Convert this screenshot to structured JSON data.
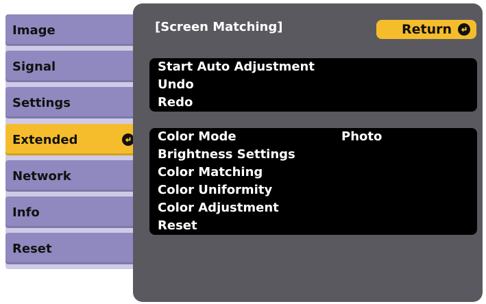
{
  "sidebar": {
    "items": [
      {
        "label": "Image"
      },
      {
        "label": "Signal"
      },
      {
        "label": "Settings"
      },
      {
        "label": "Extended"
      },
      {
        "label": "Network"
      },
      {
        "label": "Info"
      },
      {
        "label": "Reset"
      }
    ]
  },
  "main": {
    "heading": "[Screen Matching]",
    "return_label": "Return",
    "group1": [
      "Start Auto Adjustment",
      "Undo",
      "Redo"
    ],
    "group2": [
      {
        "label": "Color Mode",
        "value": "Photo"
      },
      {
        "label": "Brightness Settings"
      },
      {
        "label": "Color Matching"
      },
      {
        "label": "Color Uniformity"
      },
      {
        "label": "Color Adjustment"
      },
      {
        "label": "Reset"
      }
    ]
  },
  "colors": {
    "highlight": "#f5bd2c",
    "tab": "#8f89bf",
    "panel": "#5a5960",
    "row": "#000000"
  },
  "icons": {
    "enter": "enter-icon"
  }
}
